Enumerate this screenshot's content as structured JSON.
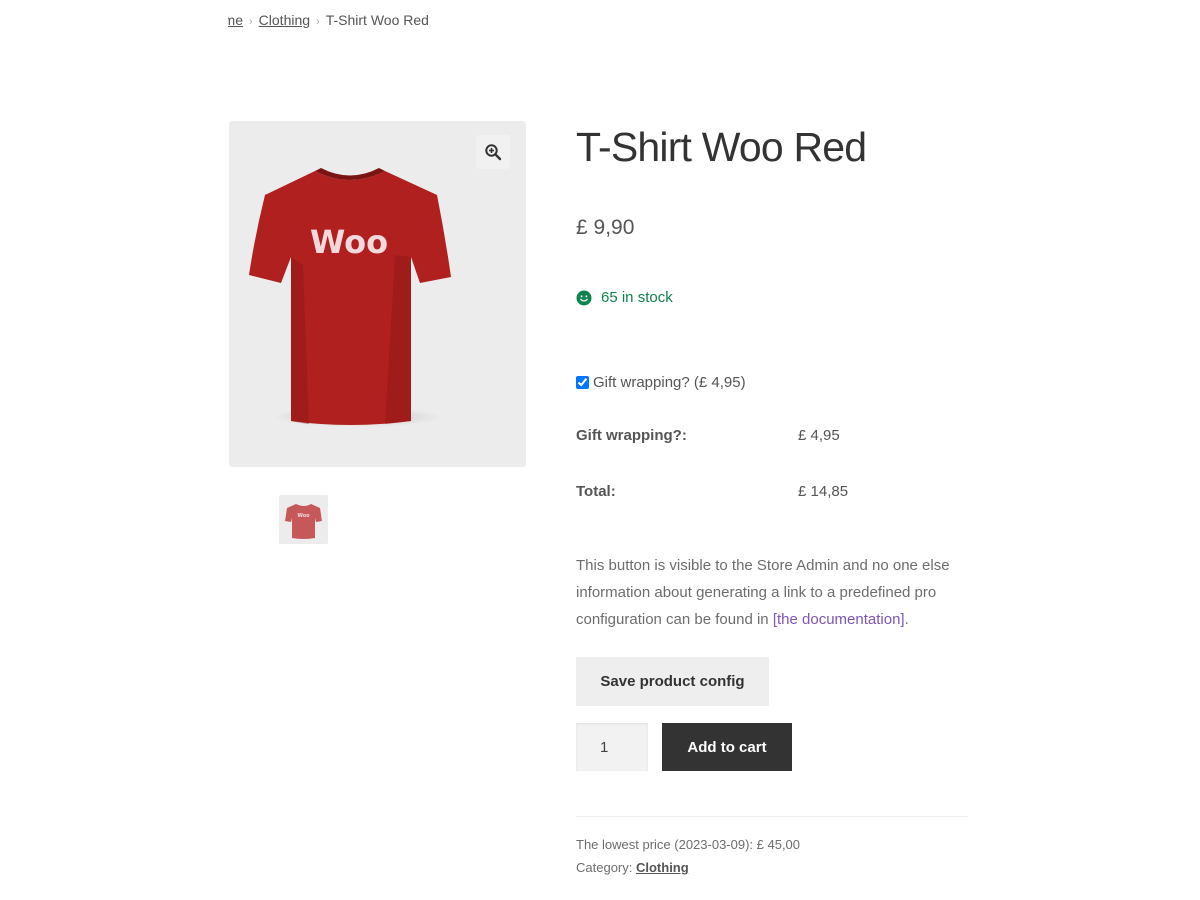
{
  "breadcrumb": {
    "home": "Home",
    "category": "Clothing",
    "current": "T-Shirt Woo Red"
  },
  "product": {
    "title": "T-Shirt Woo Red",
    "price": "£ 9,90",
    "stock": "65 in stock",
    "image_text": "Woo",
    "shirt_color": "#b0201e"
  },
  "addon": {
    "label": "Gift wrapping? (£ 4,95)",
    "checked": true
  },
  "totals": {
    "gift_label": "Gift wrapping?:",
    "gift_value": "£ 4,95",
    "total_label": "Total:",
    "total_value": "£ 14,85"
  },
  "admin_note": {
    "line1": "This button is visible to the Store Admin and no one else",
    "line2": "information about generating a link to a predefined pro",
    "line3_prefix": "configuration can be found in ",
    "link_open": "[",
    "link_text": "the documentation",
    "link_close": "]",
    "line3_suffix": "."
  },
  "actions": {
    "save_config": "Save product config",
    "quantity": "1",
    "add_to_cart": "Add to cart"
  },
  "meta": {
    "lowest_price": "The lowest price (2023-03-09): £ 45,00",
    "category_label": "Category: ",
    "category_value": "Clothing"
  },
  "colors": {
    "stock_green": "#0f834d",
    "link_purple": "#7f54b3",
    "button_dark": "#333333"
  },
  "icons": {
    "zoom": "magnifier-plus-icon",
    "stock": "smiley-icon",
    "separator": "chevron-right-icon"
  }
}
